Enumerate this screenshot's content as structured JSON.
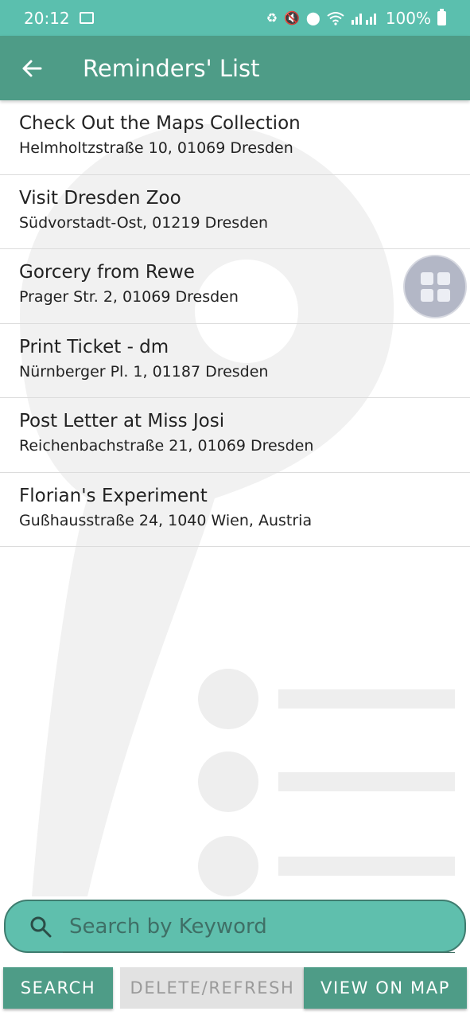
{
  "status_bar": {
    "time": "20:12",
    "battery": "100%"
  },
  "app_bar": {
    "title": "Reminders' List"
  },
  "reminders": [
    {
      "title": "Check Out the Maps Collection",
      "address": "Helmholtzstraße 10, 01069 Dresden"
    },
    {
      "title": "Visit Dresden Zoo",
      "address": "Südvorstadt-Ost, 01219 Dresden"
    },
    {
      "title": "Gorcery from Rewe",
      "address": "Prager Str. 2, 01069 Dresden"
    },
    {
      "title": "Print Ticket - dm",
      "address": "Nürnberger Pl. 1, 01187 Dresden"
    },
    {
      "title": "Post Letter at Miss Josi",
      "address": "Reichenbachstraße 21, 01069 Dresden"
    },
    {
      "title": "Florian's Experiment",
      "address": "Gußhausstraße 24, 1040 Wien, Austria"
    }
  ],
  "search": {
    "placeholder": "Search by Keyword",
    "value": ""
  },
  "buttons": {
    "search": "SEARCH",
    "delete_refresh": "DELETE/REFRESH",
    "view_on_map": "VIEW ON MAP"
  },
  "colors": {
    "status_bar": "#5bbfae",
    "app_bar": "#4e9c87",
    "search_bar": "#5fbfad",
    "disabled_button": "#e2e2e2"
  },
  "icons": [
    "gallery-icon",
    "back-arrow-icon",
    "search-icon",
    "apps-grid-icon",
    "battery-icon",
    "wifi-icon",
    "signal-icon",
    "location-icon",
    "mute-icon"
  ]
}
